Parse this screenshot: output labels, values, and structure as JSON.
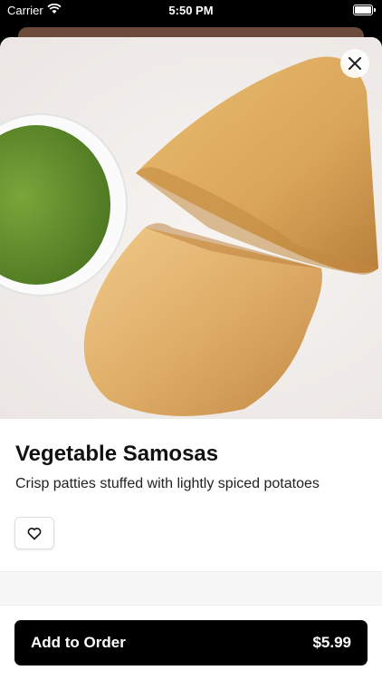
{
  "status_bar": {
    "carrier": "Carrier",
    "time": "5:50 PM"
  },
  "item": {
    "name": "Vegetable Samosas",
    "description": "Crisp patties stuffed with lightly spiced potatoes"
  },
  "actions": {
    "add_label": "Add to Order",
    "price": "$5.99"
  },
  "icons": {
    "close": "close-icon",
    "favorite": "heart-icon",
    "wifi": "wifi-icon",
    "battery": "battery-icon"
  },
  "colors": {
    "primary_button": "#000000",
    "chutney_green": "#5e8a2c",
    "samosa_gold": "#d9a55a"
  }
}
